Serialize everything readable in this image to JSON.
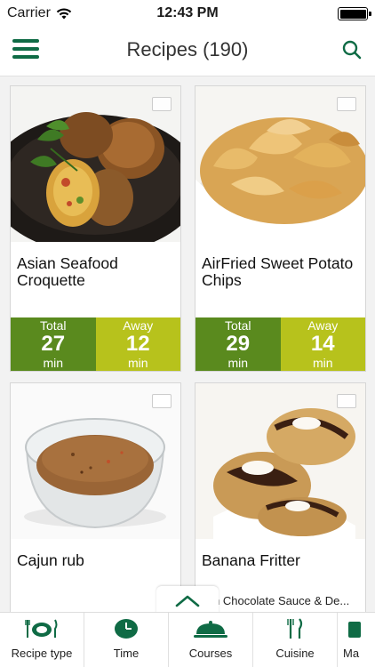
{
  "status": {
    "carrier": "Carrier",
    "time": "12:43 PM"
  },
  "header": {
    "title": "Recipes (190)"
  },
  "recipes": [
    {
      "name": "Asian Seafood Croquette",
      "total_label": "Total",
      "total": "27",
      "total_unit": "min",
      "away_label": "Away",
      "away": "12",
      "away_unit": "min"
    },
    {
      "name": "AirFried Sweet Potato Chips",
      "total_label": "Total",
      "total": "29",
      "total_unit": "min",
      "away_label": "Away",
      "away": "14",
      "away_unit": "min"
    },
    {
      "name": "Cajun rub"
    },
    {
      "name": "Banana Fritter"
    }
  ],
  "partial_subtitle": "h Chocolate Sauce & De...",
  "tabs": [
    {
      "label": "Recipe type",
      "icon": "plate-cutlery-icon"
    },
    {
      "label": "Time",
      "icon": "clock-icon"
    },
    {
      "label": "Courses",
      "icon": "cloche-icon"
    },
    {
      "label": "Cuisine",
      "icon": "fork-knife-icon"
    },
    {
      "label": "Ma",
      "icon": "partial-icon"
    }
  ],
  "colors": {
    "brand": "#0f6b45",
    "total": "#5a8a1e",
    "away": "#b7c21c"
  }
}
